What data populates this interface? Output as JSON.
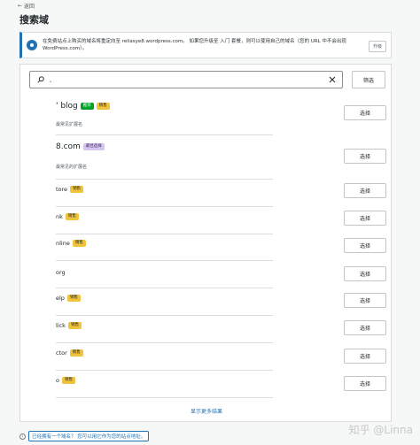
{
  "header": {
    "back_label": "返回",
    "title": "搜索域"
  },
  "notice": {
    "text": "在免费站点上购买的域名将重定向至 reliasye8.wordpress.com。 如果您升级至 入门 套餐，则可以使用自己的域名（您的 URL 中不会出现 WordPress.com）。",
    "button_label": "升级"
  },
  "search": {
    "value": "、",
    "placeholder": "",
    "filter_label": "筛选"
  },
  "results": [
    {
      "name": "' blog",
      "badges": [
        {
          "label": "推荐",
          "kind": "rec"
        },
        {
          "label": "销售",
          "kind": "sale"
        }
      ],
      "desc": "最常见扩展名",
      "size": "large"
    },
    {
      "name": "8.com",
      "badges": [
        {
          "label": "最佳选择",
          "kind": "best"
        }
      ],
      "desc": "最常见的扩展名",
      "size": "large"
    },
    {
      "name": "tore",
      "badges": [
        {
          "label": "销售",
          "kind": "sale"
        }
      ],
      "desc": "",
      "size": "small"
    },
    {
      "name": "nk",
      "badges": [
        {
          "label": "销售",
          "kind": "sale"
        }
      ],
      "desc": "",
      "size": "small"
    },
    {
      "name": "nline",
      "badges": [
        {
          "label": "销售",
          "kind": "sale"
        }
      ],
      "desc": "",
      "size": "small"
    },
    {
      "name": "org",
      "badges": [],
      "desc": "",
      "size": "small"
    },
    {
      "name": "elp",
      "badges": [
        {
          "label": "销售",
          "kind": "sale"
        }
      ],
      "desc": "",
      "size": "small"
    },
    {
      "name": "lick",
      "badges": [
        {
          "label": "销售",
          "kind": "sale"
        }
      ],
      "desc": "",
      "size": "small"
    },
    {
      "name": "ctor",
      "badges": [
        {
          "label": "销售",
          "kind": "sale"
        }
      ],
      "desc": "",
      "size": "small"
    },
    {
      "name": "o",
      "badges": [
        {
          "label": "销售",
          "kind": "sale"
        }
      ],
      "desc": "",
      "size": "small"
    }
  ],
  "select_label": "选择",
  "more_label": "显示更多结果",
  "footer": {
    "icon_glyph": "i",
    "link": "已经拥有一个域名？ 您可以用它作为您的站点地址。"
  },
  "watermark": "知乎 @Linna"
}
